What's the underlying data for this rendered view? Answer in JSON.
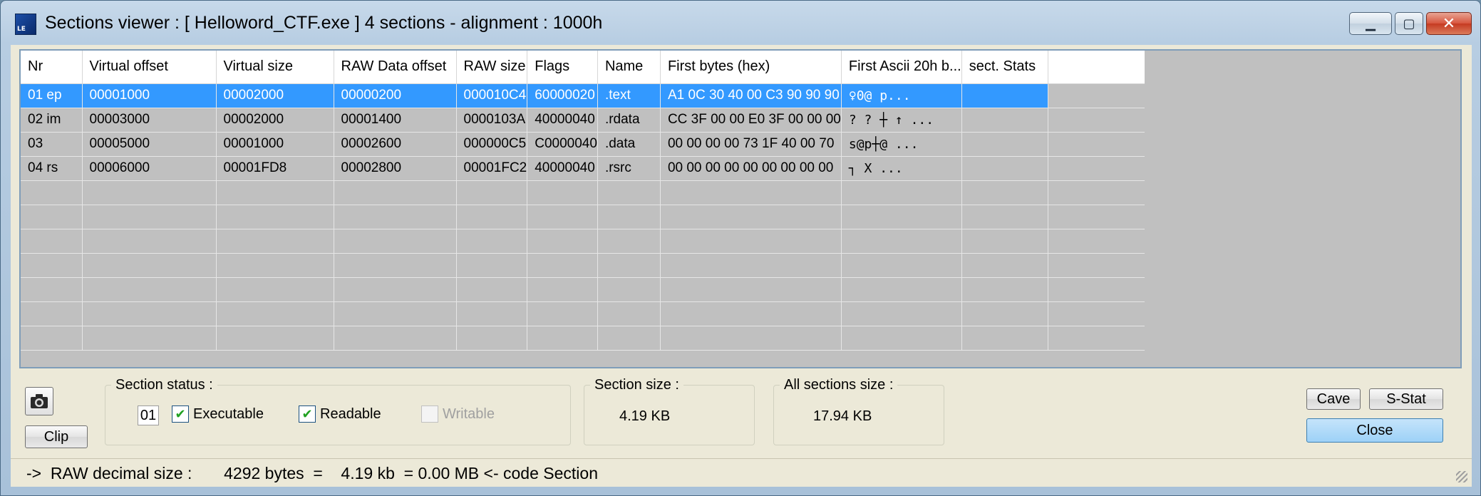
{
  "window": {
    "title": "Sections viewer :  [ Helloword_CTF.exe ] 4 sections - alignment : 1000h",
    "icon_text": "LE",
    "controls": {
      "minimize": "▁",
      "maximize": "▢",
      "close": "✕"
    }
  },
  "table": {
    "columns": [
      "Nr",
      "Virtual offset",
      "Virtual size",
      "RAW Data offset",
      "RAW size",
      "Flags",
      "Name",
      "First bytes (hex)",
      "First Ascii 20h b...",
      "sect. Stats",
      ""
    ],
    "rows": [
      [
        "01 ep",
        "00001000",
        "00002000",
        "00000200",
        "000010C4",
        "60000020",
        ".text",
        "A1 0C 30 40 00 C3 90 90 90",
        " ♀0@       p...",
        "",
        ""
      ],
      [
        "02 im",
        "00003000",
        "00002000",
        "00001400",
        "0000103A",
        "40000040",
        ".rdata",
        "CC 3F 00 00 E0 3F 00 00 00",
        "?  ?    ┼  ↑  ...",
        "",
        ""
      ],
      [
        "03",
        "00005000",
        "00001000",
        "00002600",
        "000000C5",
        "C0000040",
        ".data",
        "00 00 00 00 73 1F 40 00 70",
        "   s@p┼@     ...",
        "",
        ""
      ],
      [
        "04 rs",
        "00006000",
        "00001FD8",
        "00002800",
        "00001FC2",
        "40000040",
        ".rsrc",
        "00 00 00 00 00 00 00 00 00",
        "          ┐  X  ...",
        "",
        ""
      ],
      [
        "",
        "",
        "",
        "",
        "",
        "",
        "",
        "",
        "",
        "",
        ""
      ],
      [
        "",
        "",
        "",
        "",
        "",
        "",
        "",
        "",
        "",
        "",
        ""
      ],
      [
        "",
        "",
        "",
        "",
        "",
        "",
        "",
        "",
        "",
        "",
        ""
      ],
      [
        "",
        "",
        "",
        "",
        "",
        "",
        "",
        "",
        "",
        "",
        ""
      ],
      [
        "",
        "",
        "",
        "",
        "",
        "",
        "",
        "",
        "",
        "",
        ""
      ],
      [
        "",
        "",
        "",
        "",
        "",
        "",
        "",
        "",
        "",
        "",
        ""
      ],
      [
        "",
        "",
        "",
        "",
        "",
        "",
        "",
        "",
        "",
        "",
        ""
      ]
    ],
    "selected_row": 0
  },
  "controls": {
    "camera_icon": "camera-icon",
    "clip_label": "Clip",
    "section_status_legend": "Section status :",
    "section_number": "01",
    "executable_label": "Executable",
    "executable_checked": true,
    "readable_label": "Readable",
    "readable_checked": true,
    "writable_label": "Writable",
    "writable_checked": false,
    "section_size_legend": "Section size :",
    "section_size_value": "4.19 KB",
    "all_sections_legend": "All sections size :",
    "all_sections_value": "17.94 KB",
    "cave_label": "Cave",
    "sstat_label": "S-Stat",
    "close_label": "Close"
  },
  "statusbar": {
    "text": "->  RAW decimal size :       4292 bytes  =    4.19 kb  = 0.00 MB <- code Section"
  },
  "colors": {
    "selection": "#3399ff",
    "grid_bg": "#c0c0c0",
    "dialog_bg": "#ece9d8"
  }
}
